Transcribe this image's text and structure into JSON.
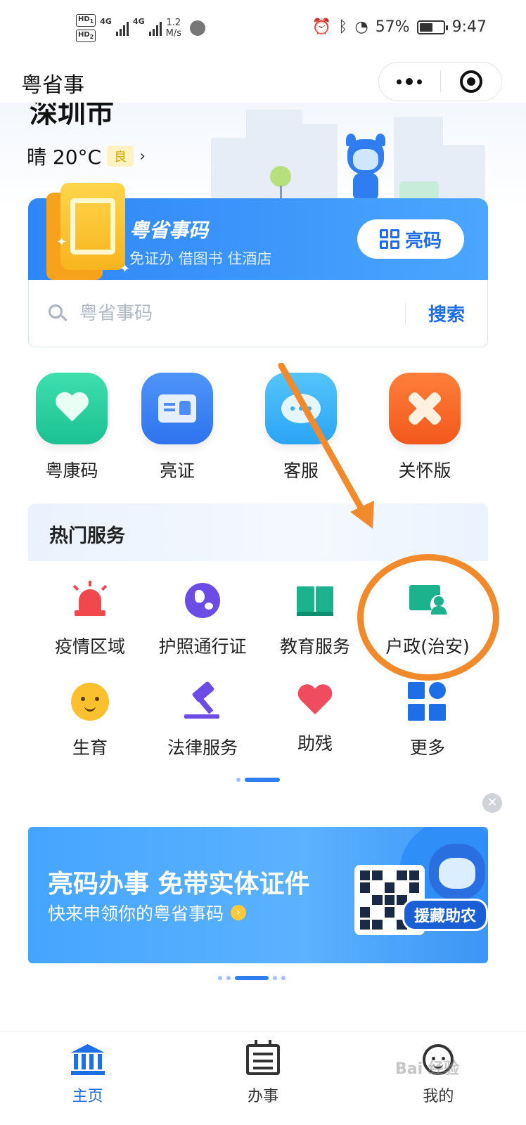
{
  "status_bar": {
    "hd1": "HD",
    "hd1_sub": "1",
    "hd2": "HD",
    "hd2_sub": "2",
    "net1": "4G",
    "net2": "4G",
    "speed_value": "1.2",
    "speed_unit": "M/s",
    "battery_percent": "57%",
    "battery_level": 0.57,
    "time": "9:47"
  },
  "title_bar": {
    "title": "粤省事"
  },
  "hero": {
    "city": "深圳市",
    "weather": "晴 20°C",
    "air_quality": "良"
  },
  "code_card": {
    "title": "粤省事码",
    "subtitle": "免证办 借图书 住酒店",
    "button_label": "亮码"
  },
  "search": {
    "placeholder": "粤省事码",
    "button_label": "搜索"
  },
  "quick_actions": [
    {
      "label": "粤康码",
      "color": "#2fd3a0"
    },
    {
      "label": "亮证",
      "color": "#3b86f5"
    },
    {
      "label": "客服",
      "color": "#3fb4f8"
    },
    {
      "label": "关怀版",
      "color": "#ff6a2a"
    }
  ],
  "hot_services": {
    "title": "热门服务",
    "items": [
      {
        "label": "疫情区域",
        "icon": "alarm-icon"
      },
      {
        "label": "护照通行证",
        "icon": "globe-icon"
      },
      {
        "label": "教育服务",
        "icon": "book-icon"
      },
      {
        "label": "户政(治安)",
        "icon": "household-icon"
      },
      {
        "label": "生育",
        "icon": "baby-icon"
      },
      {
        "label": "法律服务",
        "icon": "gavel-icon"
      },
      {
        "label": "助残",
        "icon": "heart-icon"
      },
      {
        "label": "更多",
        "icon": "more-grid-icon"
      }
    ]
  },
  "banner": {
    "title": "亮码办事 免带实体证件",
    "subtitle": "快来申领你的粤省事码",
    "tag": "援藏助农"
  },
  "tab_bar": {
    "tabs": [
      {
        "label": "主页",
        "active": true
      },
      {
        "label": "办事",
        "active": false
      },
      {
        "label": "我的",
        "active": false
      }
    ]
  },
  "watermark": "Bai 经验",
  "colors": {
    "accent": "#1e6ee8",
    "annotation": "#f28a2b"
  }
}
